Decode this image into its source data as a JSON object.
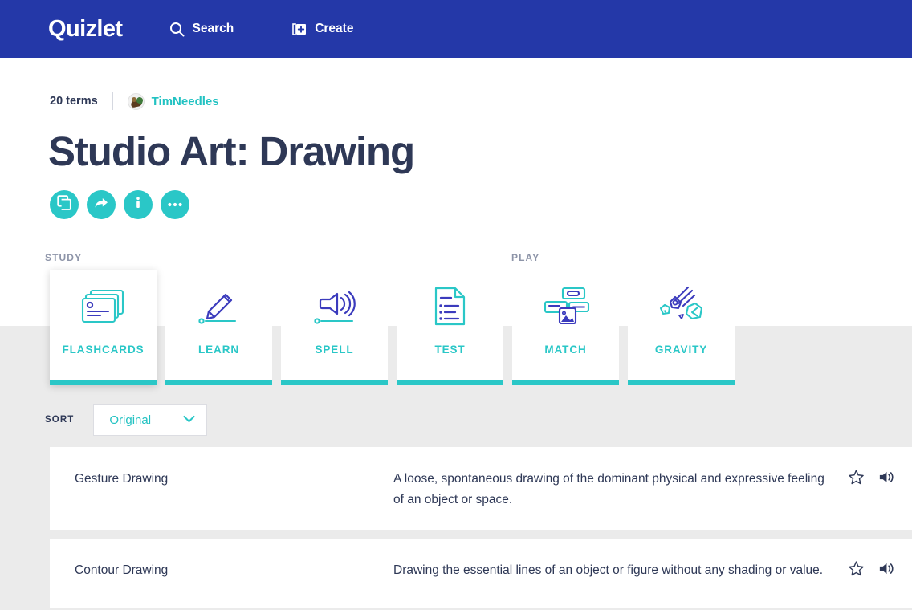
{
  "navbar": {
    "brand": "Quizlet",
    "items": [
      {
        "label": "Search",
        "icon": "search-icon"
      },
      {
        "label": "Create",
        "icon": "create-icon"
      }
    ]
  },
  "meta": {
    "term_count": "20 terms",
    "author": "TimNeedles",
    "avatar_icon": "avatar"
  },
  "page_title": "Studio Art: Drawing",
  "actions": [
    {
      "name": "copy-button",
      "icon": "copy-icon"
    },
    {
      "name": "share-button",
      "icon": "share-arrow-icon"
    },
    {
      "name": "info-button",
      "icon": "info-icon"
    },
    {
      "name": "more-button",
      "icon": "ellipsis-icon"
    }
  ],
  "sections": {
    "study_label": "STUDY",
    "play_label": "PLAY"
  },
  "modes": [
    {
      "label": "FLASHCARDS",
      "icon": "flashcards-icon",
      "group": "study",
      "highlighted": true
    },
    {
      "label": "LEARN",
      "icon": "pencil-icon",
      "group": "study",
      "highlighted": false
    },
    {
      "label": "SPELL",
      "icon": "speaker-waves-icon",
      "group": "study",
      "highlighted": false
    },
    {
      "label": "TEST",
      "icon": "document-list-icon",
      "group": "study",
      "highlighted": false
    },
    {
      "label": "MATCH",
      "icon": "match-cards-icon",
      "group": "play",
      "highlighted": false
    },
    {
      "label": "GRAVITY",
      "icon": "asteroid-icon",
      "group": "play",
      "highlighted": false
    }
  ],
  "sort": {
    "label": "SORT",
    "value": "Original",
    "chevron_icon": "chevron-down-icon"
  },
  "terms": [
    {
      "word": "Gesture Drawing",
      "definition": "A loose, spontaneous drawing of the dominant physical and expressive feeling of an object or space.",
      "star_icon": "star-icon",
      "audio_icon": "speaker-icon"
    },
    {
      "word": "Contour Drawing",
      "definition": "Drawing the essential lines of an object or figure without any shading or value.",
      "star_icon": "star-icon",
      "audio_icon": "speaker-icon"
    }
  ],
  "colors": {
    "nav_blue": "#2438a8",
    "teal": "#2ac7c7",
    "text_dark": "#2e3856",
    "page_grey": "#ebebeb",
    "icon_blue": "#3b3bbd"
  }
}
